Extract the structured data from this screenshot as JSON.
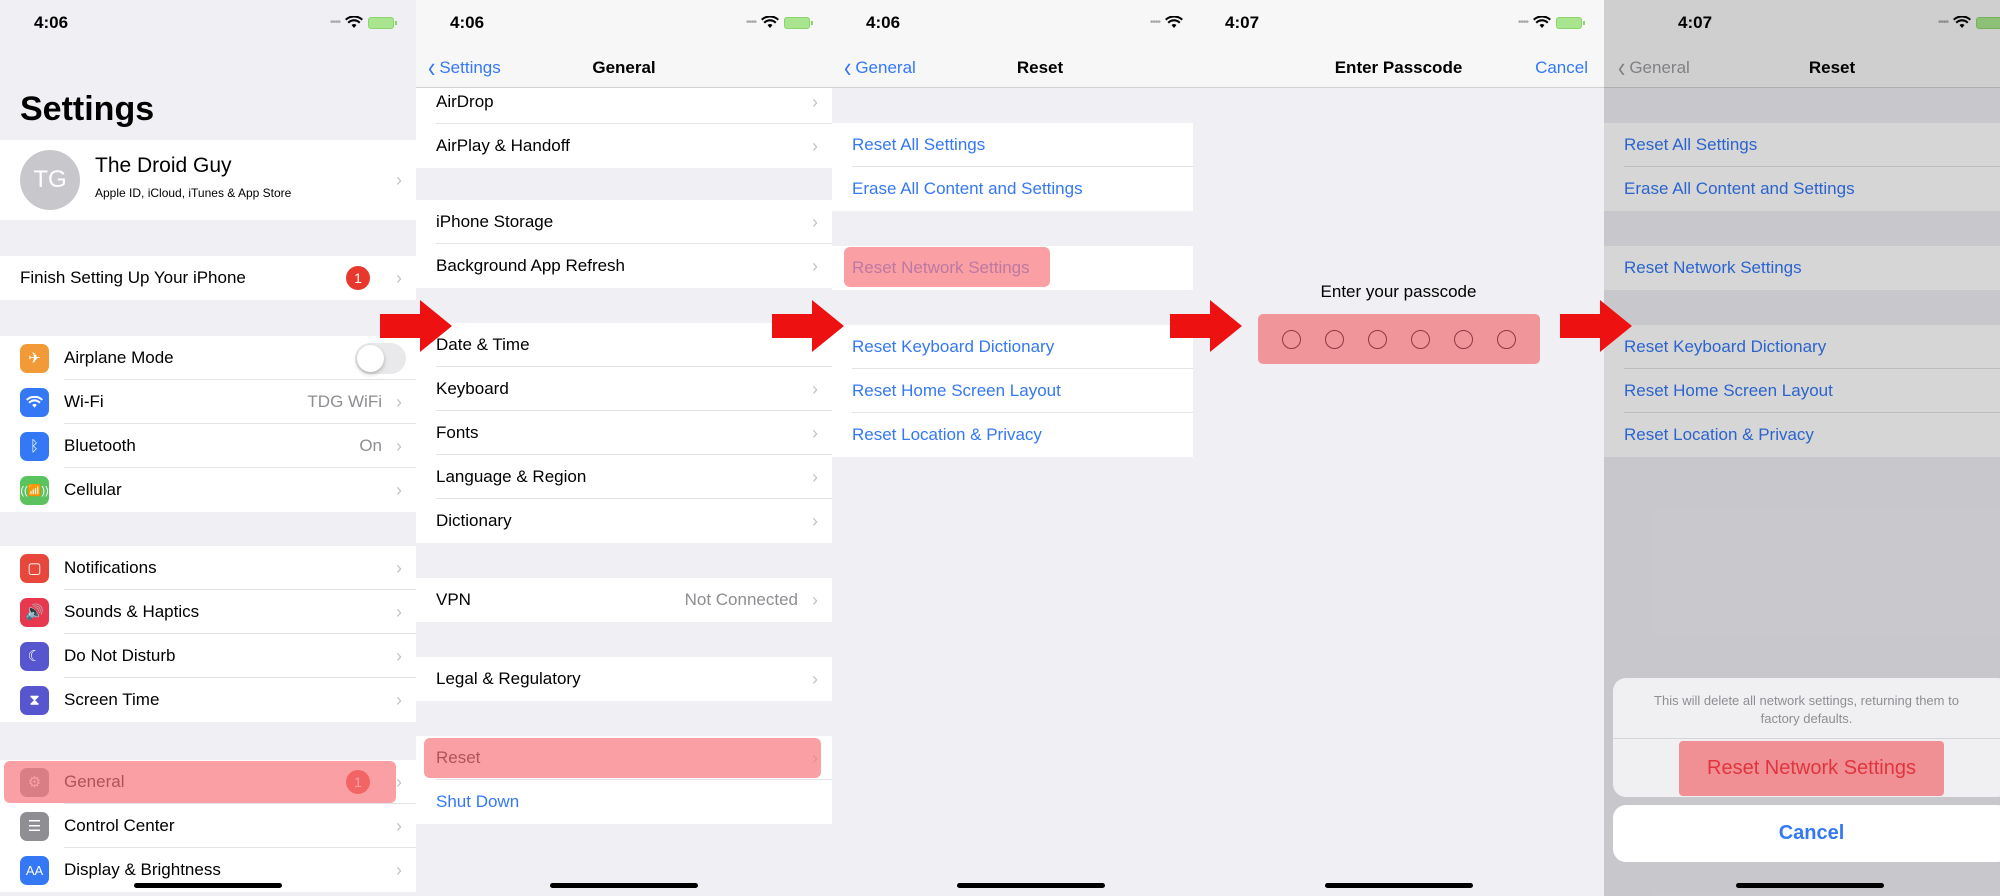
{
  "panels": [
    {
      "status_time": "4:06",
      "title": "Settings",
      "profile": {
        "initials": "TG",
        "name": "The Droid Guy",
        "subtitle": "Apple ID, iCloud, iTunes & App Store"
      },
      "finish_setup": {
        "label": "Finish Setting Up Your iPhone",
        "badge": "1"
      },
      "connectivity": [
        {
          "label": "Airplane Mode",
          "icon": "airplane-icon",
          "color": "#f19a37",
          "toggle": false
        },
        {
          "label": "Wi-Fi",
          "icon": "wifi-icon",
          "color": "#3478f6",
          "value": "TDG WiFi"
        },
        {
          "label": "Bluetooth",
          "icon": "bluetooth-icon",
          "color": "#3478f6",
          "value": "On"
        },
        {
          "label": "Cellular",
          "icon": "cellular-icon",
          "color": "#5ac35d"
        }
      ],
      "alerts": [
        {
          "label": "Notifications",
          "icon": "notifications-icon",
          "color": "#e8473c"
        },
        {
          "label": "Sounds & Haptics",
          "icon": "sound-icon",
          "color": "#e8384f"
        },
        {
          "label": "Do Not Disturb",
          "icon": "moon-icon",
          "color": "#5756ce"
        },
        {
          "label": "Screen Time",
          "icon": "hourglass-icon",
          "color": "#5756ce"
        }
      ],
      "system": [
        {
          "label": "General",
          "icon": "gear-icon",
          "color": "#8e8e93",
          "badge": "1",
          "highlighted": true
        },
        {
          "label": "Control Center",
          "icon": "control-center-icon",
          "color": "#8e8e93"
        },
        {
          "label": "Display & Brightness",
          "icon": "display-icon",
          "color": "#3478f6",
          "icon_text": "AA"
        }
      ]
    },
    {
      "status_time": "4:06",
      "back": "Settings",
      "title": "General",
      "items": [
        "AirDrop",
        "AirPlay & Handoff",
        "iPhone Storage",
        "Background App Refresh",
        "Date & Time",
        "Keyboard",
        "Fonts",
        "Language & Region",
        "Dictionary"
      ],
      "vpn": {
        "label": "VPN",
        "value": "Not Connected"
      },
      "legal": "Legal & Regulatory",
      "reset": "Reset",
      "shutdown": "Shut Down"
    },
    {
      "status_time": "4:06",
      "back": "General",
      "title": "Reset",
      "items": [
        "Reset All Settings",
        "Erase All Content and Settings",
        "Reset Network Settings",
        "Reset Keyboard Dictionary",
        "Reset Home Screen Layout",
        "Reset Location & Privacy"
      ]
    },
    {
      "status_time": "4:07",
      "title": "Enter Passcode",
      "cancel": "Cancel",
      "prompt": "Enter your passcode",
      "digits": 6,
      "entered": 0
    },
    {
      "status_time": "4:07",
      "back": "General",
      "title": "Reset",
      "items": [
        "Reset All Settings",
        "Erase All Content and Settings",
        "Reset Network Settings",
        "Reset Keyboard Dictionary",
        "Reset Home Screen Layout",
        "Reset Location & Privacy"
      ],
      "sheet": {
        "message": "This will delete all network settings, returning them to factory defaults.",
        "action": "Reset Network Settings",
        "cancel": "Cancel"
      }
    }
  ],
  "colors": {
    "accent": "#3478f6",
    "highlight": "#f8787d",
    "arrow": "#ee1111",
    "destructive": "#e0353f"
  }
}
